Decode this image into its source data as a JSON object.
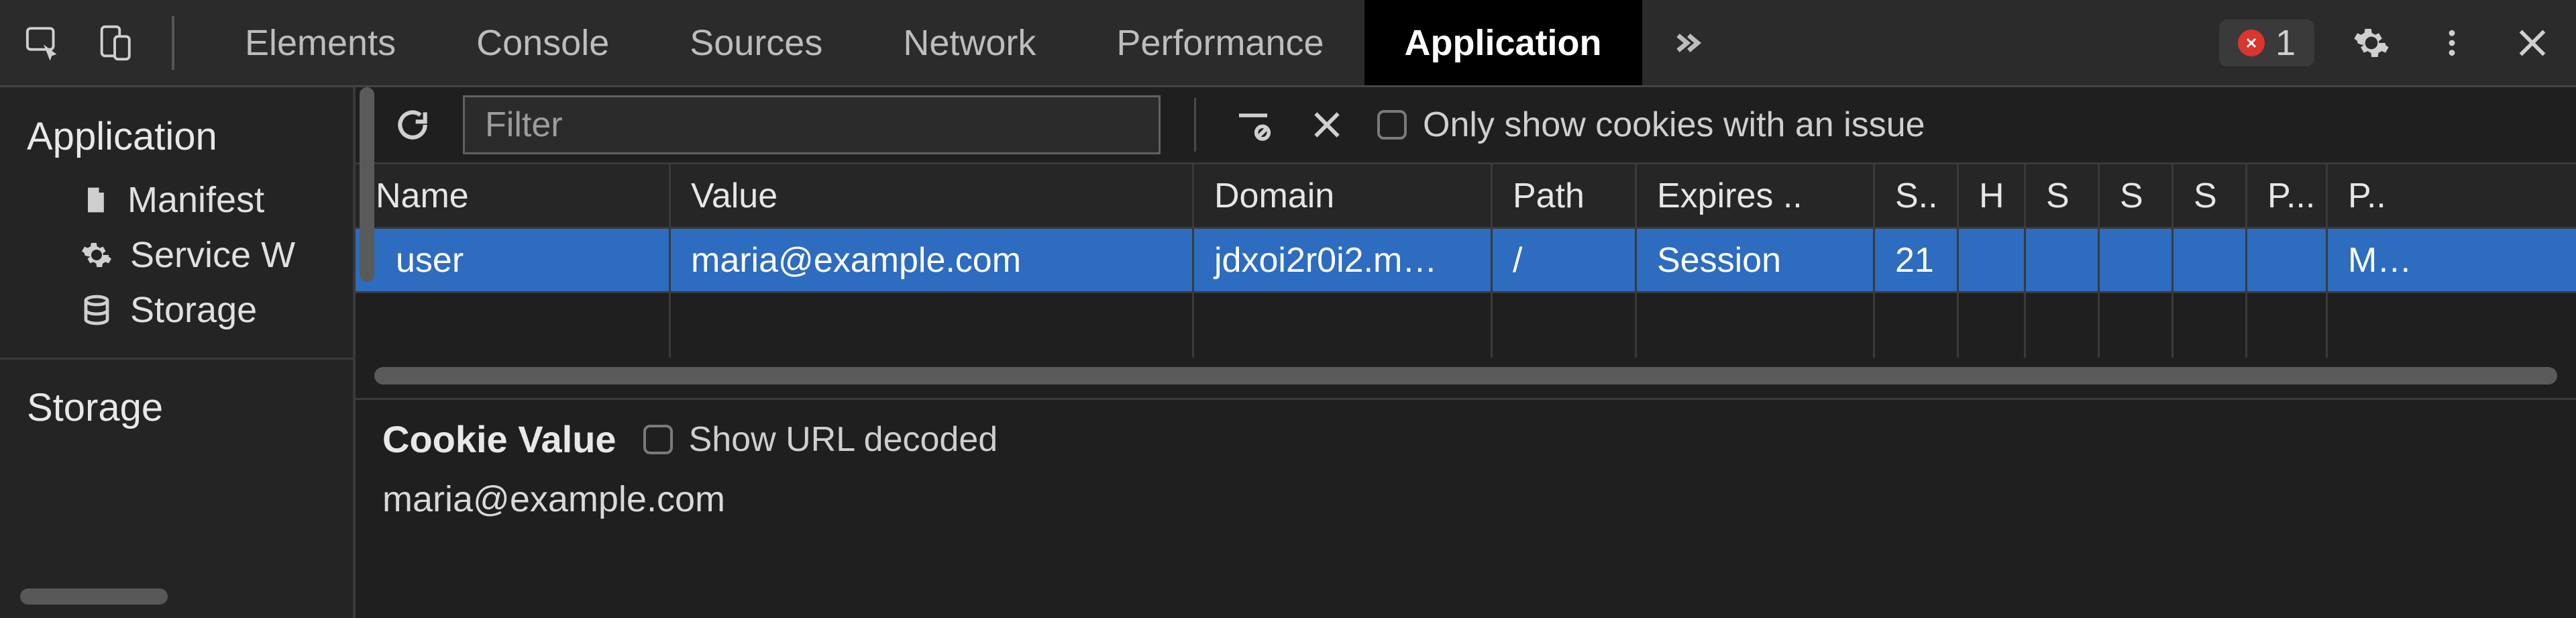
{
  "topbar": {
    "tabs": {
      "elements": "Elements",
      "console": "Console",
      "sources": "Sources",
      "network": "Network",
      "performance": "Performance",
      "application": "Application"
    },
    "error_count": "1"
  },
  "sidebar": {
    "section_application": "Application",
    "manifest": "Manifest",
    "service_workers": "Service W",
    "storage": "Storage",
    "section_storage": "Storage"
  },
  "toolbar": {
    "filter_placeholder": "Filter",
    "only_issue_label": "Only show cookies with an issue"
  },
  "cookies": {
    "headers": {
      "name": "Name",
      "value": "Value",
      "domain": "Domain",
      "path": "Path",
      "expires": "Expires ..",
      "size": "S..",
      "httponly": "H",
      "secure": "S",
      "samesite": "S",
      "sameparty": "S",
      "partitionkey": "P...",
      "priority": "P.."
    },
    "rows": [
      {
        "name": "user",
        "value": "maria@example.com",
        "domain": "jdxoi2r0i2.m…",
        "path": "/",
        "expires": "Session",
        "size": "21",
        "httponly": "",
        "secure": "",
        "samesite": "",
        "sameparty": "",
        "partitionkey": "",
        "priority": "M…"
      }
    ]
  },
  "details": {
    "title": "Cookie Value",
    "show_decoded_label": "Show URL decoded",
    "value": "maria@example.com"
  }
}
